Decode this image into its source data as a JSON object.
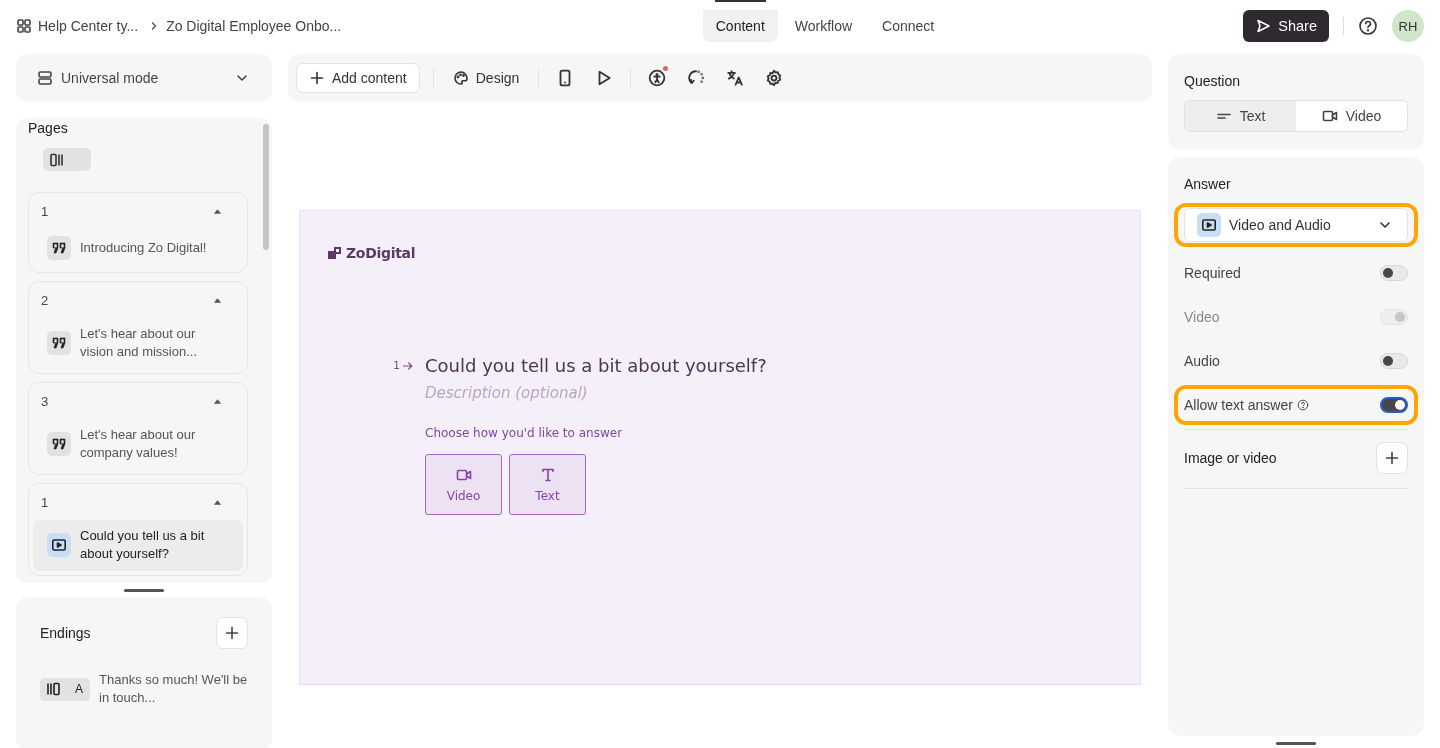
{
  "breadcrumb": {
    "items": [
      "Help Center ty...",
      "Zo Digital Employee Onbo..."
    ]
  },
  "top_tabs": [
    {
      "label": "Content",
      "selected": true
    },
    {
      "label": "Workflow",
      "selected": false
    },
    {
      "label": "Connect",
      "selected": false
    }
  ],
  "share_button": "Share",
  "avatar": "RH",
  "mode_dropdown": "Universal mode",
  "pages": {
    "title": "Pages",
    "view_toggle": {
      "on": true
    },
    "items": [
      {
        "number": "1",
        "title": "Introducing Zo Digital!",
        "kind": "statement",
        "selected": false
      },
      {
        "number": "2",
        "title": "Let's hear about our vision and mission...",
        "kind": "statement",
        "selected": false
      },
      {
        "number": "3",
        "title": "Let's hear about our company values!",
        "kind": "statement",
        "selected": false
      },
      {
        "number": "1",
        "title": "Could you tell us a bit about yourself?",
        "kind": "video",
        "selected": true
      }
    ]
  },
  "endings": {
    "title": "Endings",
    "items": [
      {
        "letter": "A",
        "title": "Thanks so much! We'll be in touch..."
      }
    ]
  },
  "toolbar": {
    "add_content": "Add content",
    "design": "Design"
  },
  "canvas": {
    "logo": "ZoDigital",
    "number": "1",
    "question": "Could you tell us a bit about yourself?",
    "description_placeholder": "Description (optional)",
    "prompt": "Choose how you'd like to answer",
    "options": [
      {
        "kind": "video",
        "label": "Video"
      },
      {
        "kind": "text",
        "label": "Text"
      }
    ]
  },
  "question_panel": {
    "title": "Question",
    "tabs": [
      {
        "kind": "text",
        "label": "Text",
        "selected": true
      },
      {
        "kind": "video",
        "label": "Video",
        "selected": false
      }
    ]
  },
  "answer_panel": {
    "title": "Answer",
    "type_dropdown": {
      "value": "Video and Audio",
      "highlighted": true
    },
    "toggles": [
      {
        "kind": "plain",
        "label": "Required",
        "on": false,
        "disabled": false,
        "highlighted": false
      },
      {
        "kind": "plain",
        "label": "Video",
        "on": true,
        "disabled": true,
        "highlighted": false
      },
      {
        "kind": "plain",
        "label": "Audio",
        "on": false,
        "disabled": false,
        "highlighted": false
      },
      {
        "kind": "with_help",
        "label": "Allow text answer",
        "on": true,
        "disabled": false,
        "highlighted": true
      }
    ],
    "media_label": "Image or video"
  }
}
